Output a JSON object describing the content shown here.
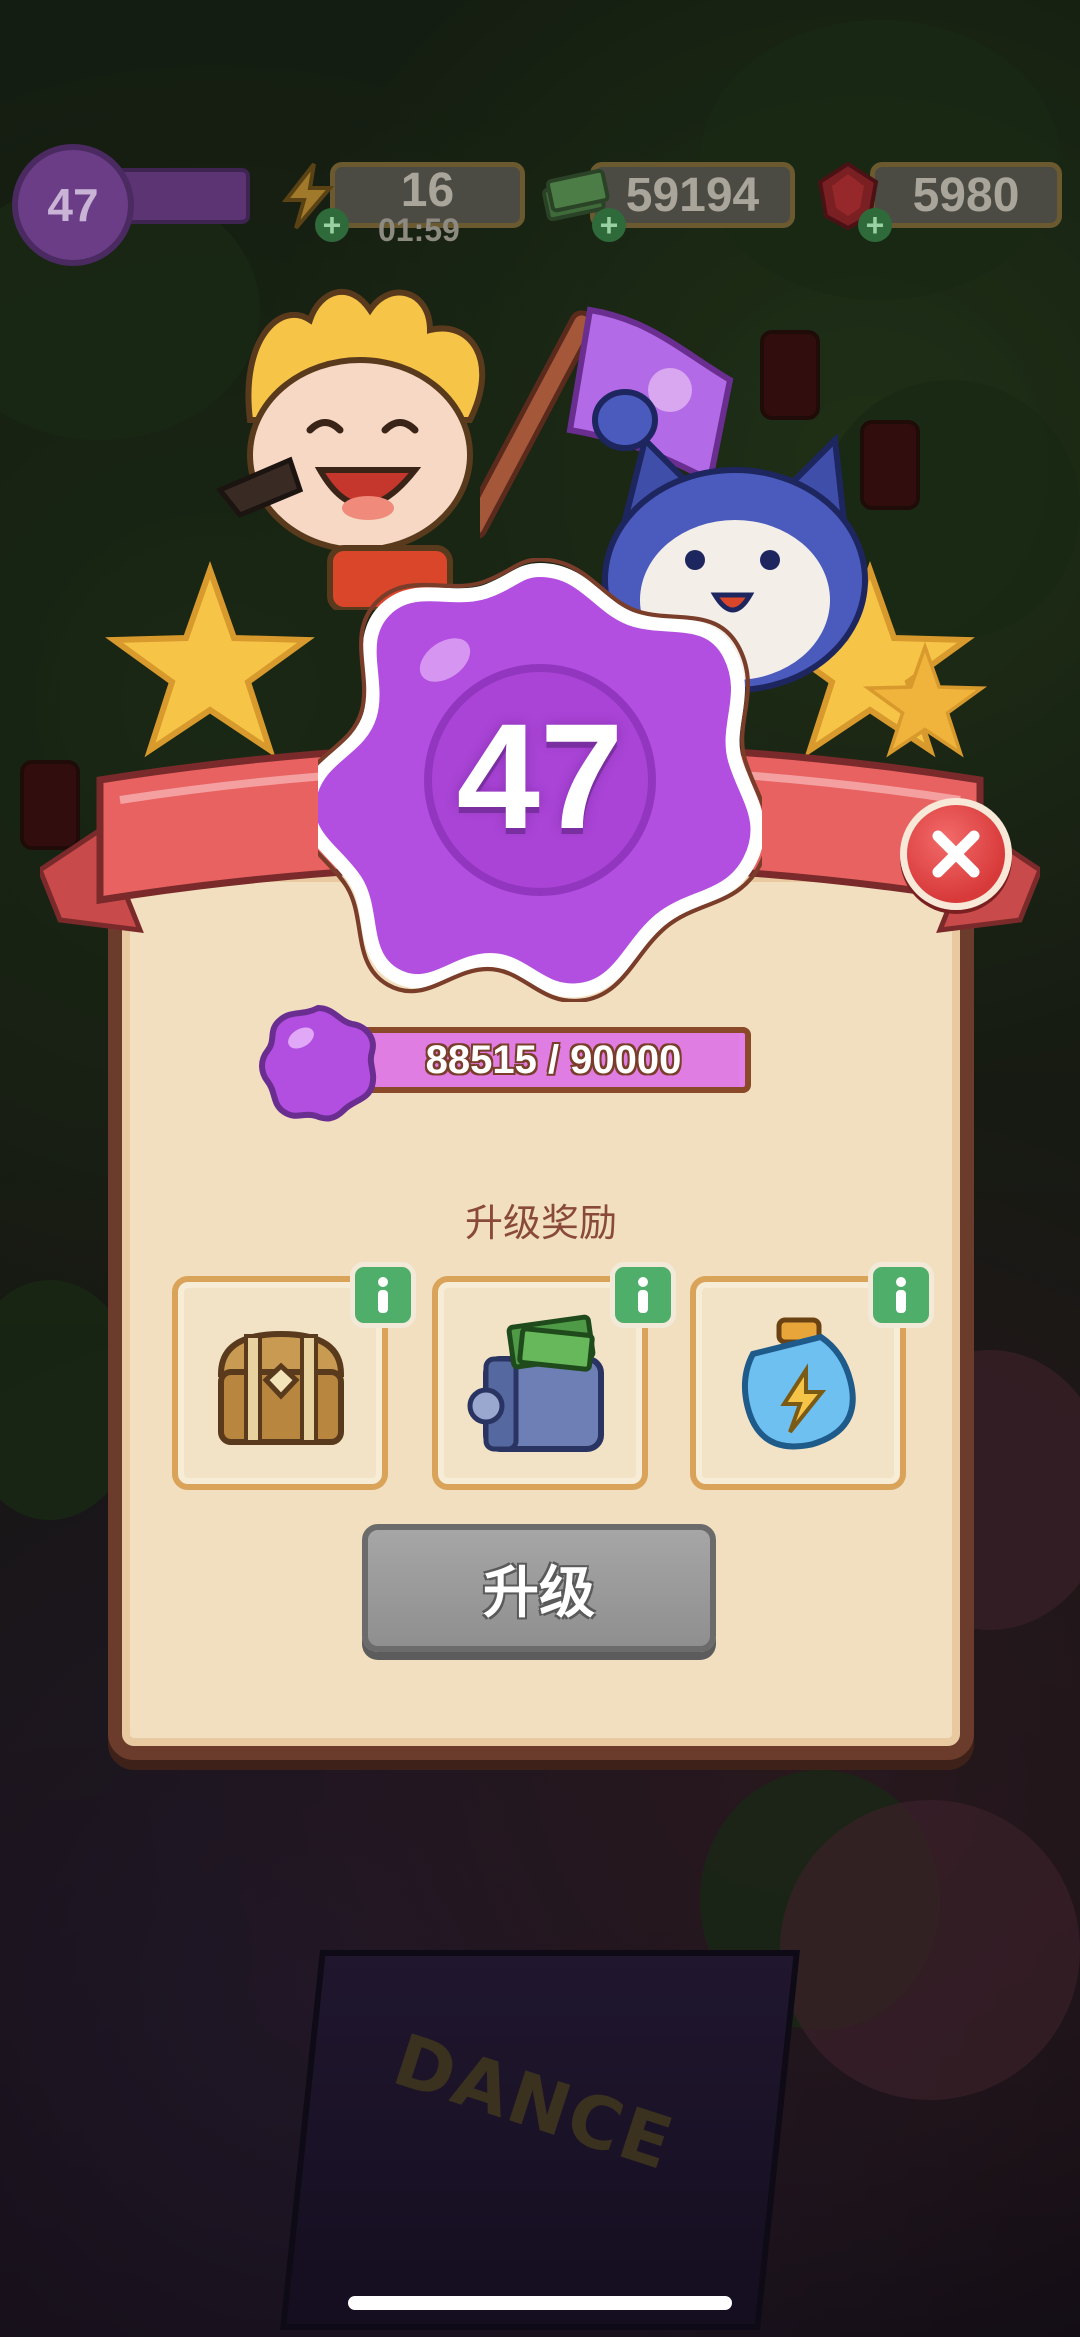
{
  "hud": {
    "level": "47",
    "energy": "16",
    "energy_timer": "01:59",
    "cash": "59194",
    "gems": "5980",
    "plus": "+"
  },
  "levelup": {
    "level": "47",
    "xp_text": "88515 / 90000",
    "xp_progress": 0.9835,
    "reward_title": "升级奖励",
    "rewards": [
      {
        "icon": "treasure-chest-icon"
      },
      {
        "icon": "cash-safe-icon"
      },
      {
        "icon": "energy-bottle-icon"
      }
    ],
    "info_label": "i",
    "upgrade_label": "升级"
  },
  "colors": {
    "panel": "#f1dfbf",
    "medal_purple": "#b24ee0",
    "ribbon_red": "#e86262",
    "info_green": "#4fae6a",
    "close_red": "#d83a3a"
  }
}
